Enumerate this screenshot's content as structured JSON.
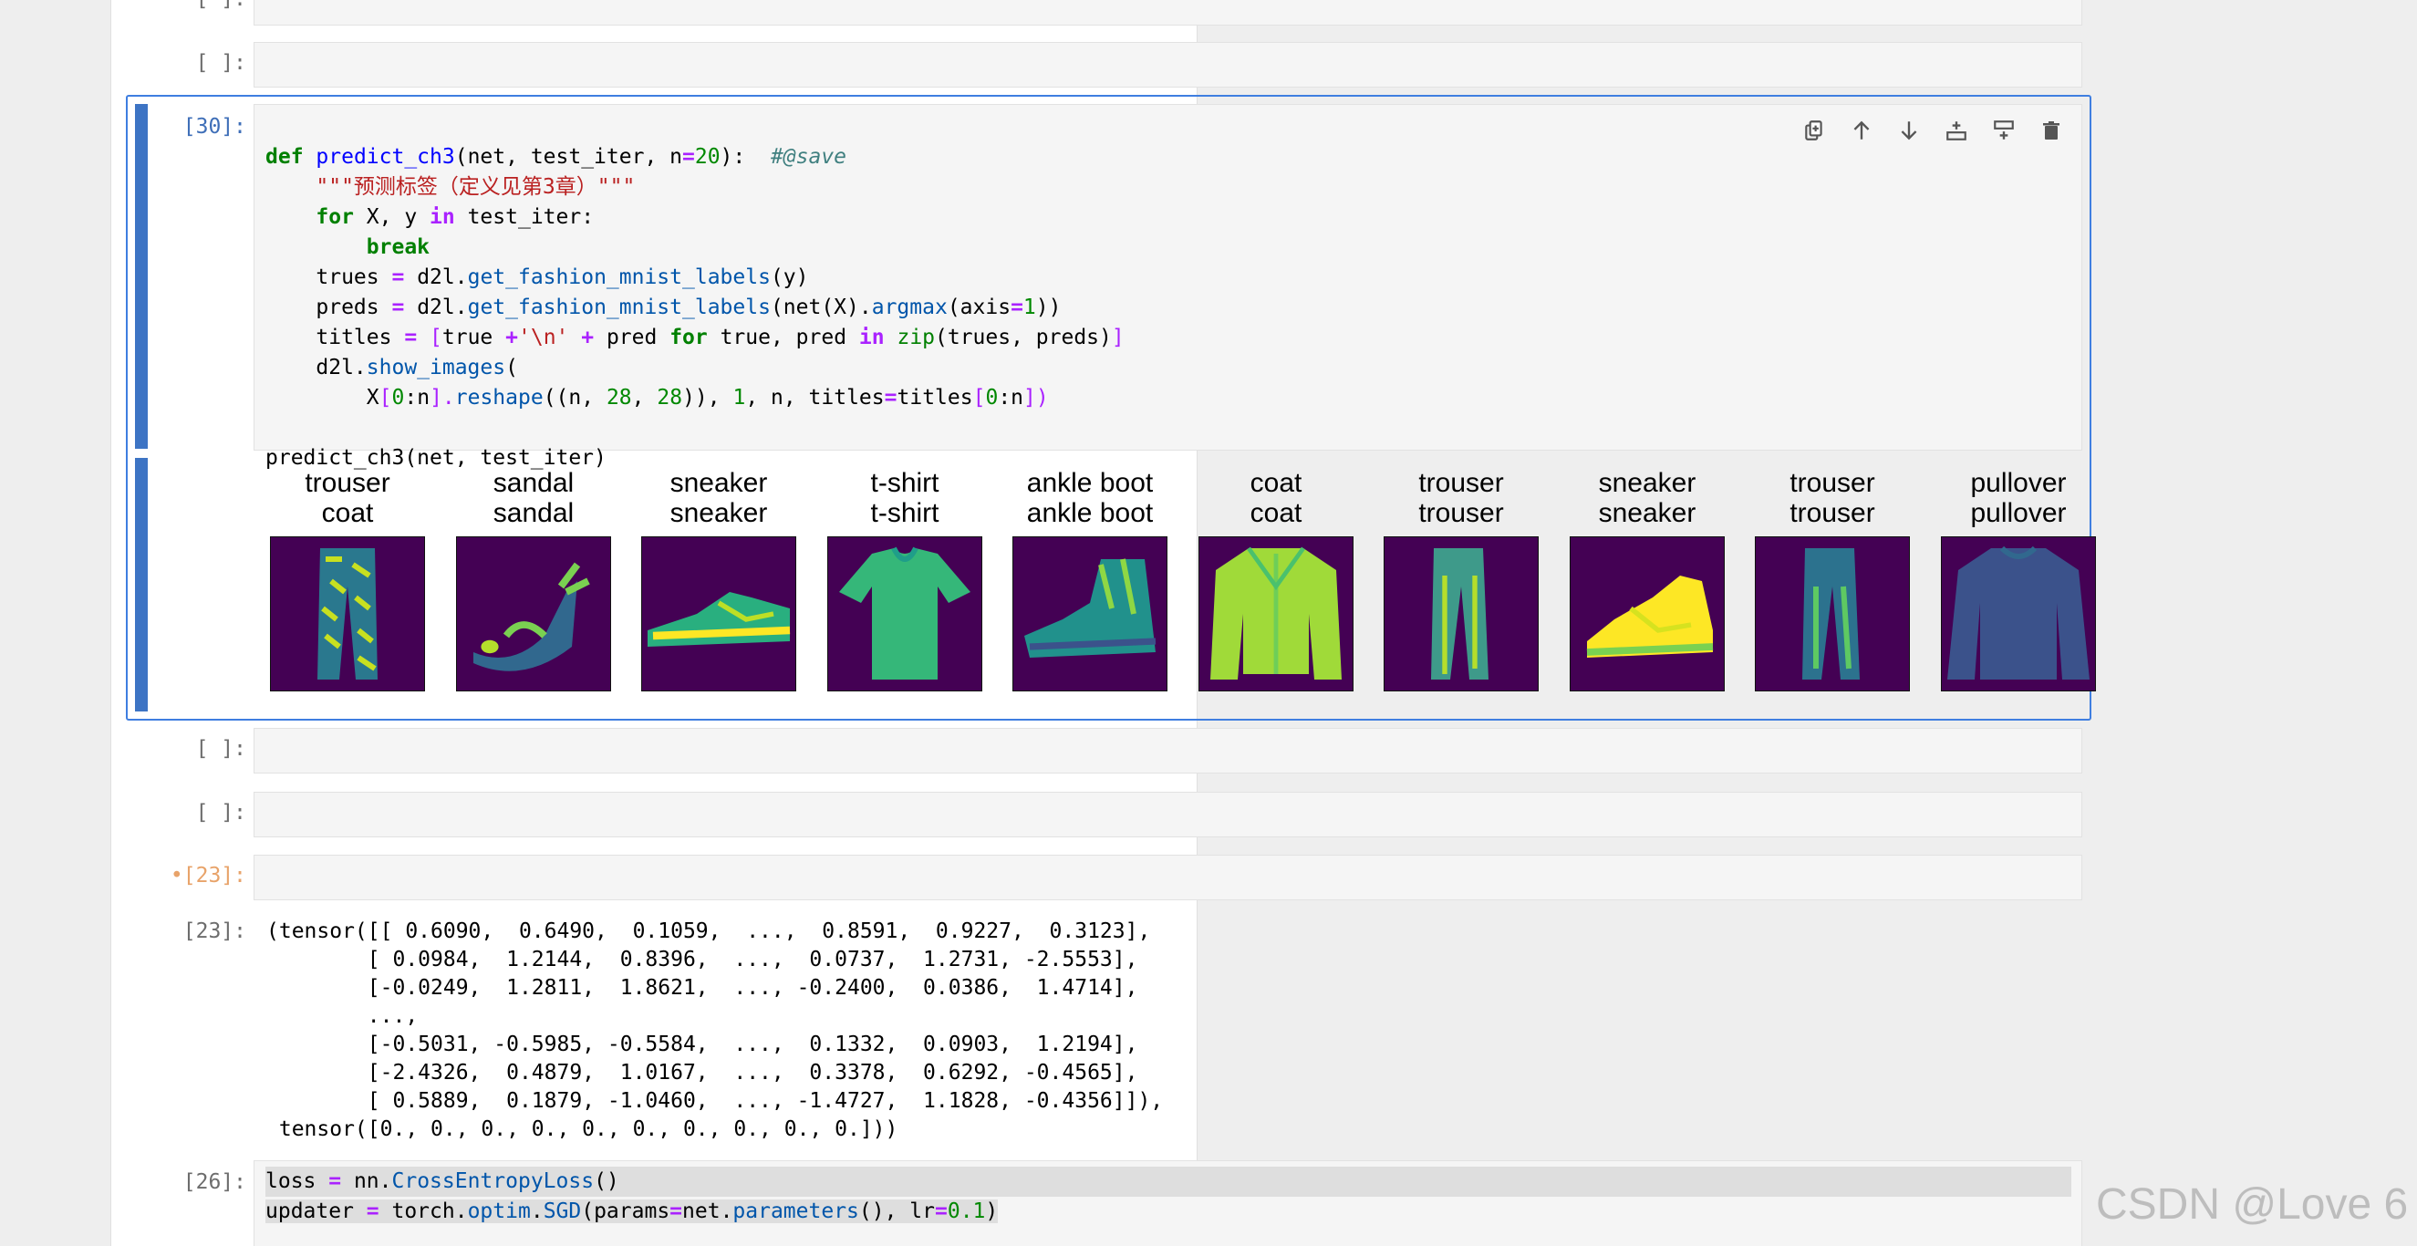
{
  "cells": {
    "empty_a_prompt": "[ ]:",
    "empty_b_prompt": "[ ]:",
    "active_prompt": "[30]:",
    "empty_c_prompt": "[ ]:",
    "empty_d_prompt": "[ ]:",
    "pending_prompt": "•[23]:",
    "out_prompt": "[23]:",
    "last_prompt": "[26]:"
  },
  "toolbar": {
    "icons": [
      "duplicate-icon",
      "move-up-icon",
      "move-down-icon",
      "insert-above-icon",
      "insert-below-icon",
      "delete-icon"
    ]
  },
  "code_active": {
    "l1": {
      "def": "def",
      "name": "predict_ch3",
      "args": "(net, test_iter, n",
      "eq": "=",
      "n20": "20",
      "close": "):  ",
      "comment": "#@save"
    },
    "l2": "\"\"\"预测标签（定义见第3章）\"\"\"",
    "l3": {
      "for": "for",
      "mid": " X, y ",
      "in": "in",
      "end": " test_iter:"
    },
    "l4": "break",
    "l5": {
      "a": "trues ",
      "eq": "=",
      "b": " d2l.",
      "fn": "get_fashion_mnist_labels",
      "c": "(y)"
    },
    "l6": {
      "a": "preds ",
      "eq": "=",
      "b": " d2l.",
      "fn": "get_fashion_mnist_labels",
      "c": "(net(X).",
      "fn2": "argmax",
      "d": "(axis",
      "eq2": "=",
      "one": "1",
      "e": "))"
    },
    "l7": {
      "a": "titles ",
      "eq": "=",
      "b": " [",
      "c": "true ",
      "plus": "+",
      "s": "'\\n'",
      "plus2": " + ",
      "d": "pred ",
      "for": "for",
      "e": " true, pred ",
      "in": "in",
      "f": " ",
      "zip": "zip",
      "g": "(trues, preds)",
      "h": "]"
    },
    "l8": {
      "a": "d2l.",
      "fn": "show_images",
      "b": "("
    },
    "l9": {
      "a": "X",
      "b": "[",
      "zero": "0",
      "c": ":n",
      "d": "].",
      "fn": "reshape",
      "e": "((n, ",
      "n28a": "28",
      "f": ", ",
      "n28b": "28",
      "g": ")), ",
      "one": "1",
      "h": ", n, titles",
      "eq": "=",
      "i": "titles",
      "j": "[",
      "zero2": "0",
      "k": ":n",
      "l": "])"
    },
    "l10": "predict_ch3(net, test_iter)"
  },
  "figure": {
    "items": [
      {
        "true": "trouser",
        "pred": "coat",
        "icon": "trouser-image"
      },
      {
        "true": "sandal",
        "pred": "sandal",
        "icon": "sandal-image"
      },
      {
        "true": "sneaker",
        "pred": "sneaker",
        "icon": "sneaker-image"
      },
      {
        "true": "t-shirt",
        "pred": "t-shirt",
        "icon": "tshirt-image"
      },
      {
        "true": "ankle boot",
        "pred": "ankle boot",
        "icon": "ankle-boot-image"
      },
      {
        "true": "coat",
        "pred": "coat",
        "icon": "coat-image"
      },
      {
        "true": "trouser",
        "pred": "trouser",
        "icon": "trouser-image"
      },
      {
        "true": "sneaker",
        "pred": "sneaker",
        "icon": "sneaker-image"
      },
      {
        "true": "trouser",
        "pred": "trouser",
        "icon": "trouser-image"
      },
      {
        "true": "pullover",
        "pred": "pullover",
        "icon": "pullover-image"
      }
    ]
  },
  "output_text": {
    "o1": "(tensor([[ 0.6090,  0.6490,  0.1059,  ...,  0.8591,  0.9227,  0.3123],",
    "o2": "        [ 0.0984,  1.2144,  0.8396,  ...,  0.0737,  1.2731, -2.5553],",
    "o3": "        [-0.0249,  1.2811,  1.8621,  ..., -0.2400,  0.0386,  1.4714],",
    "o4": "        ...,",
    "o5": "        [-0.5031, -0.5985, -0.5584,  ...,  0.1332,  0.0903,  1.2194],",
    "o6": "        [-2.4326,  0.4879,  1.0167,  ...,  0.3378,  0.6292, -0.4565],",
    "o7": "        [ 0.5889,  0.1879, -1.0460,  ..., -1.4727,  1.1828, -0.4356]]),",
    "o8": " tensor([0., 0., 0., 0., 0., 0., 0., 0., 0., 0.]))"
  },
  "code_last": {
    "l1": {
      "a": "loss ",
      "eq": "=",
      "b": " nn.",
      "fn": "CrossEntropyLoss",
      "c": "()"
    },
    "l2": {
      "a": "updater ",
      "eq": "=",
      "b": " torch.",
      "m": "optim",
      "dot": ".",
      "fn": "SGD",
      "c": "(params",
      "eq2": "=",
      "d": "net.",
      "fn2": "parameters",
      "e": "(), lr",
      "eq3": "=",
      "num": "0.1",
      "f": ")"
    }
  },
  "watermark": "CSDN @Love 6",
  "colors": {
    "accent": "#3f7ee0",
    "collapser": "#3d74c4",
    "viridis_bg": "#440154"
  }
}
